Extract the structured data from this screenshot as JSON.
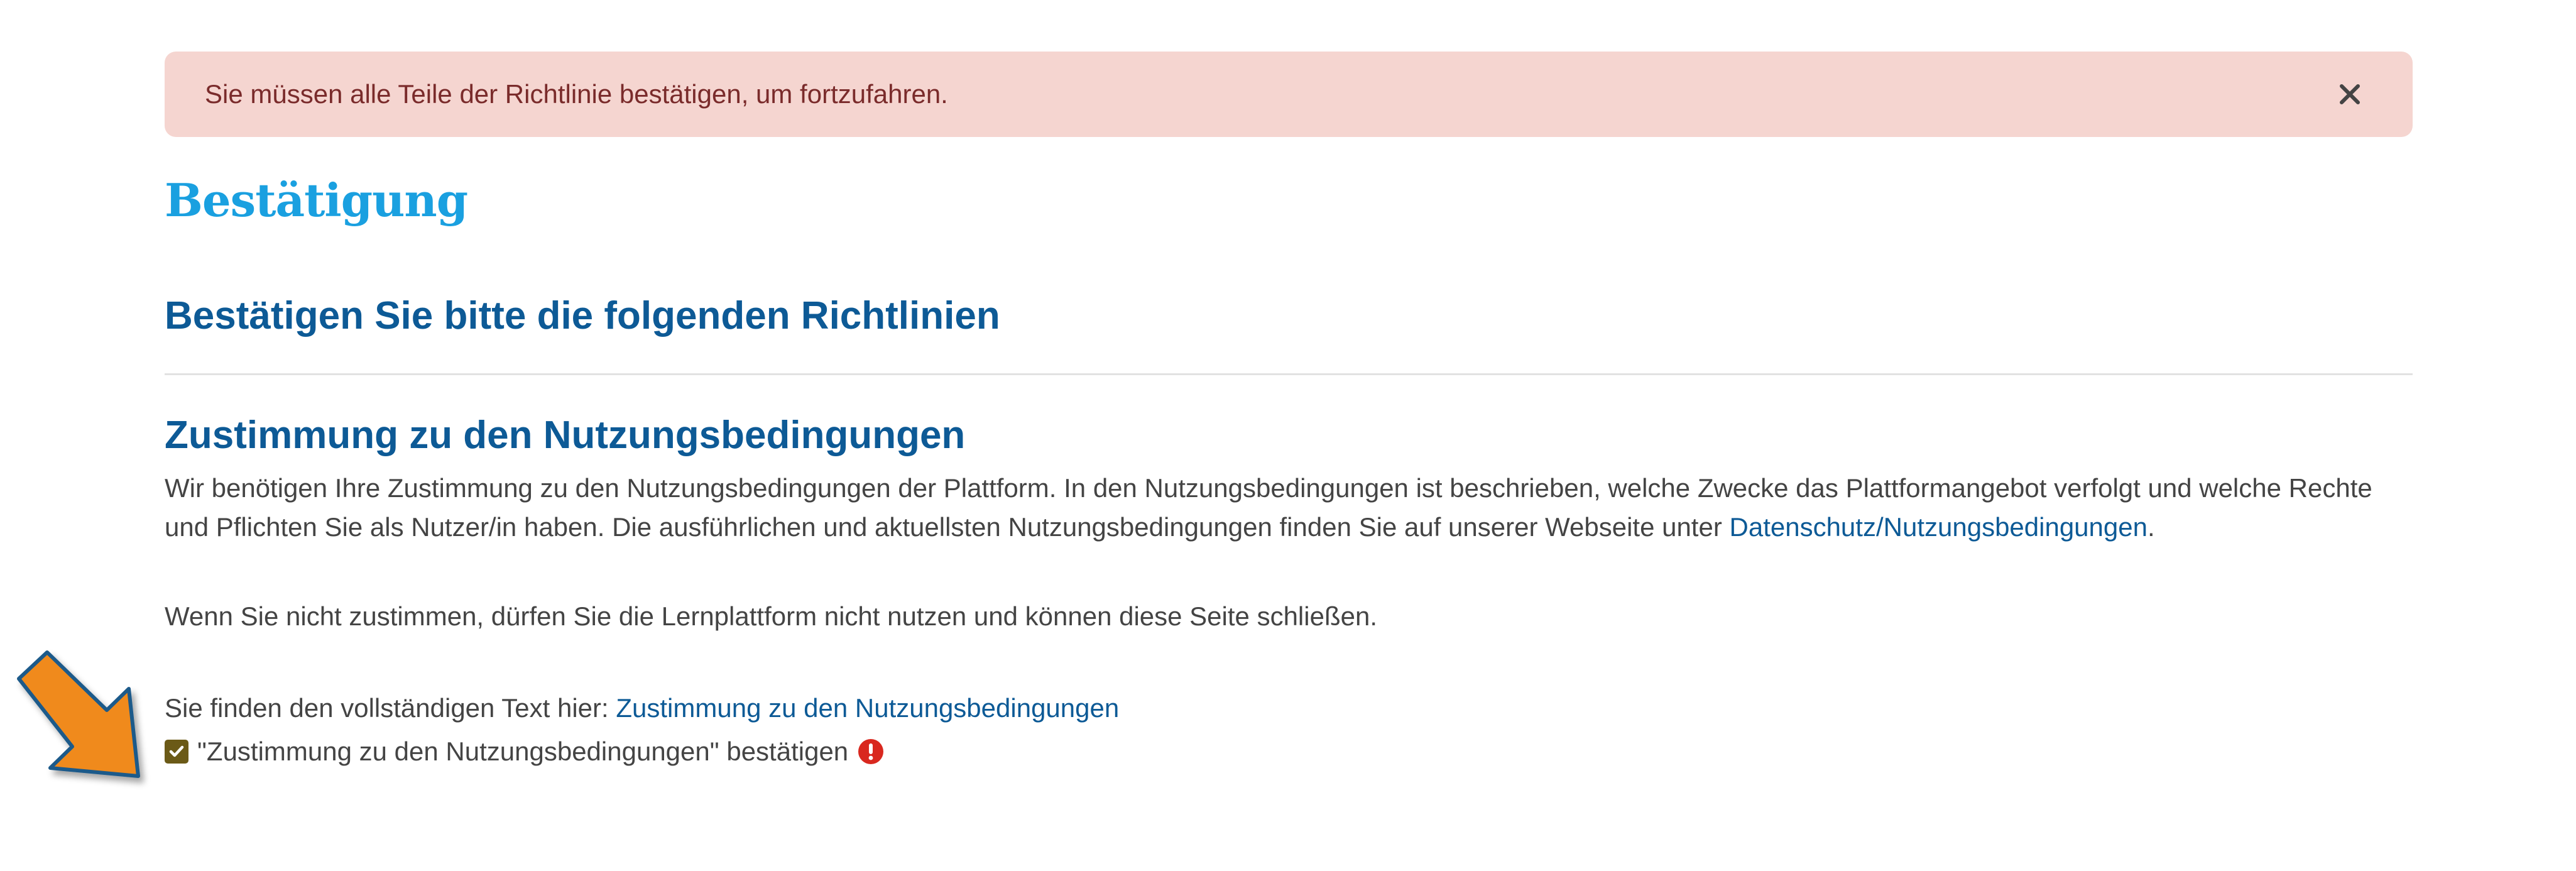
{
  "alert": {
    "message": "Sie müssen alle Teile der Richtlinie bestätigen, um fortzufahren.",
    "close_icon": "close-icon"
  },
  "page": {
    "title": "Bestätigung",
    "subtitle": "Bestätigen Sie bitte die folgenden Richtlinien"
  },
  "policy": {
    "title": "Zustimmung zu den Nutzungsbedingungen",
    "paragraph1": "Wir benötigen Ihre Zustimmung zu den Nutzungsbedingungen der Plattform. In den Nutzungsbedingungen ist beschrieben, welche Zwecke das Plattformangebot verfolgt und welche Rechte und Pflichten Sie als Nutzer/in haben. Die ausführlichen und aktuellsten Nutzungsbedingungen finden Sie auf unserer Webseite unter ",
    "paragraph1_link": "Datenschutz/Nutzungsbedingungen",
    "paragraph1_end": ".",
    "paragraph2": "Wenn Sie nicht zustimmen, dürfen Sie die Lernplattform nicht nutzen und können diese Seite schließen.",
    "fulltext_prefix": "Sie finden den vollständigen Text hier: ",
    "fulltext_link": "Zustimmung zu den Nutzungsbedingungen",
    "confirm_label": "\"Zustimmung zu den Nutzungsbedingungen\" bestätigen",
    "confirm_checked": true,
    "required_icon": "exclamation-circle-icon"
  },
  "colors": {
    "alert_bg": "#f5d5d0",
    "title": "#1aa0e0",
    "heading": "#0d5a96",
    "link": "#0d5a96",
    "required": "#d9281f",
    "checkbox": "#6b5a17",
    "annotation_arrow": "#f08a1c"
  }
}
